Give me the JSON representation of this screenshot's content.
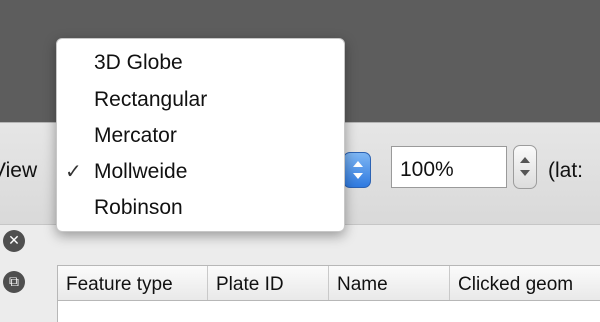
{
  "toolbar": {
    "view_label": "View",
    "zoom_value": "100%",
    "coordinate_label": "(lat:"
  },
  "projection_menu": {
    "items": [
      {
        "label": "3D Globe",
        "checked": false
      },
      {
        "label": "Rectangular",
        "checked": false
      },
      {
        "label": "Mercator",
        "checked": false
      },
      {
        "label": "Mollweide",
        "checked": true
      },
      {
        "label": "Robinson",
        "checked": false
      }
    ],
    "check_glyph": "✓"
  },
  "panel": {
    "close_glyph": "✕",
    "restore_glyph": "⧉",
    "table_headers": [
      "Feature type",
      "Plate ID",
      "Name",
      "Clicked geom"
    ]
  },
  "colors": {
    "dark_band": "#5d5d5d",
    "accent_blue": "#2f7ae0"
  }
}
